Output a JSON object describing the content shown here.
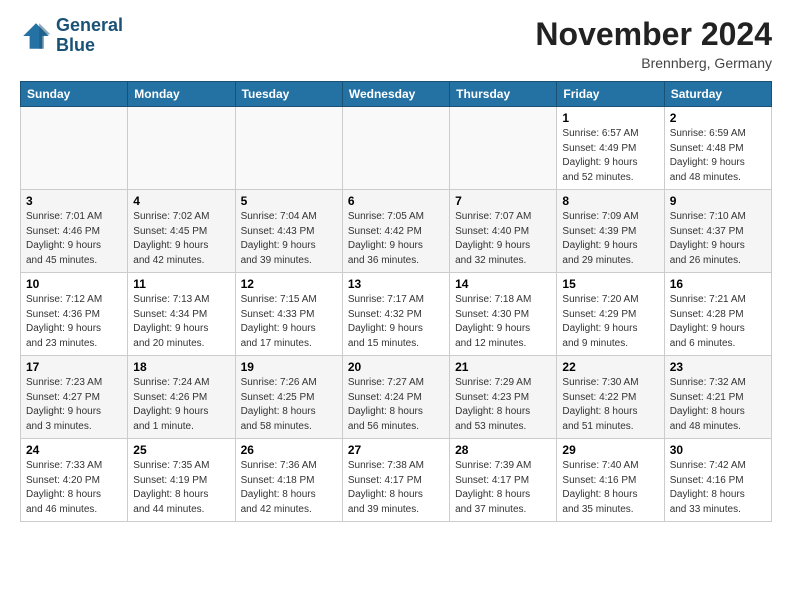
{
  "header": {
    "logo_line1": "General",
    "logo_line2": "Blue",
    "month": "November 2024",
    "location": "Brennberg, Germany"
  },
  "days_of_week": [
    "Sunday",
    "Monday",
    "Tuesday",
    "Wednesday",
    "Thursday",
    "Friday",
    "Saturday"
  ],
  "weeks": [
    [
      {
        "day": "",
        "info": ""
      },
      {
        "day": "",
        "info": ""
      },
      {
        "day": "",
        "info": ""
      },
      {
        "day": "",
        "info": ""
      },
      {
        "day": "",
        "info": ""
      },
      {
        "day": "1",
        "info": "Sunrise: 6:57 AM\nSunset: 4:49 PM\nDaylight: 9 hours\nand 52 minutes."
      },
      {
        "day": "2",
        "info": "Sunrise: 6:59 AM\nSunset: 4:48 PM\nDaylight: 9 hours\nand 48 minutes."
      }
    ],
    [
      {
        "day": "3",
        "info": "Sunrise: 7:01 AM\nSunset: 4:46 PM\nDaylight: 9 hours\nand 45 minutes."
      },
      {
        "day": "4",
        "info": "Sunrise: 7:02 AM\nSunset: 4:45 PM\nDaylight: 9 hours\nand 42 minutes."
      },
      {
        "day": "5",
        "info": "Sunrise: 7:04 AM\nSunset: 4:43 PM\nDaylight: 9 hours\nand 39 minutes."
      },
      {
        "day": "6",
        "info": "Sunrise: 7:05 AM\nSunset: 4:42 PM\nDaylight: 9 hours\nand 36 minutes."
      },
      {
        "day": "7",
        "info": "Sunrise: 7:07 AM\nSunset: 4:40 PM\nDaylight: 9 hours\nand 32 minutes."
      },
      {
        "day": "8",
        "info": "Sunrise: 7:09 AM\nSunset: 4:39 PM\nDaylight: 9 hours\nand 29 minutes."
      },
      {
        "day": "9",
        "info": "Sunrise: 7:10 AM\nSunset: 4:37 PM\nDaylight: 9 hours\nand 26 minutes."
      }
    ],
    [
      {
        "day": "10",
        "info": "Sunrise: 7:12 AM\nSunset: 4:36 PM\nDaylight: 9 hours\nand 23 minutes."
      },
      {
        "day": "11",
        "info": "Sunrise: 7:13 AM\nSunset: 4:34 PM\nDaylight: 9 hours\nand 20 minutes."
      },
      {
        "day": "12",
        "info": "Sunrise: 7:15 AM\nSunset: 4:33 PM\nDaylight: 9 hours\nand 17 minutes."
      },
      {
        "day": "13",
        "info": "Sunrise: 7:17 AM\nSunset: 4:32 PM\nDaylight: 9 hours\nand 15 minutes."
      },
      {
        "day": "14",
        "info": "Sunrise: 7:18 AM\nSunset: 4:30 PM\nDaylight: 9 hours\nand 12 minutes."
      },
      {
        "day": "15",
        "info": "Sunrise: 7:20 AM\nSunset: 4:29 PM\nDaylight: 9 hours\nand 9 minutes."
      },
      {
        "day": "16",
        "info": "Sunrise: 7:21 AM\nSunset: 4:28 PM\nDaylight: 9 hours\nand 6 minutes."
      }
    ],
    [
      {
        "day": "17",
        "info": "Sunrise: 7:23 AM\nSunset: 4:27 PM\nDaylight: 9 hours\nand 3 minutes."
      },
      {
        "day": "18",
        "info": "Sunrise: 7:24 AM\nSunset: 4:26 PM\nDaylight: 9 hours\nand 1 minute."
      },
      {
        "day": "19",
        "info": "Sunrise: 7:26 AM\nSunset: 4:25 PM\nDaylight: 8 hours\nand 58 minutes."
      },
      {
        "day": "20",
        "info": "Sunrise: 7:27 AM\nSunset: 4:24 PM\nDaylight: 8 hours\nand 56 minutes."
      },
      {
        "day": "21",
        "info": "Sunrise: 7:29 AM\nSunset: 4:23 PM\nDaylight: 8 hours\nand 53 minutes."
      },
      {
        "day": "22",
        "info": "Sunrise: 7:30 AM\nSunset: 4:22 PM\nDaylight: 8 hours\nand 51 minutes."
      },
      {
        "day": "23",
        "info": "Sunrise: 7:32 AM\nSunset: 4:21 PM\nDaylight: 8 hours\nand 48 minutes."
      }
    ],
    [
      {
        "day": "24",
        "info": "Sunrise: 7:33 AM\nSunset: 4:20 PM\nDaylight: 8 hours\nand 46 minutes."
      },
      {
        "day": "25",
        "info": "Sunrise: 7:35 AM\nSunset: 4:19 PM\nDaylight: 8 hours\nand 44 minutes."
      },
      {
        "day": "26",
        "info": "Sunrise: 7:36 AM\nSunset: 4:18 PM\nDaylight: 8 hours\nand 42 minutes."
      },
      {
        "day": "27",
        "info": "Sunrise: 7:38 AM\nSunset: 4:17 PM\nDaylight: 8 hours\nand 39 minutes."
      },
      {
        "day": "28",
        "info": "Sunrise: 7:39 AM\nSunset: 4:17 PM\nDaylight: 8 hours\nand 37 minutes."
      },
      {
        "day": "29",
        "info": "Sunrise: 7:40 AM\nSunset: 4:16 PM\nDaylight: 8 hours\nand 35 minutes."
      },
      {
        "day": "30",
        "info": "Sunrise: 7:42 AM\nSunset: 4:16 PM\nDaylight: 8 hours\nand 33 minutes."
      }
    ]
  ]
}
